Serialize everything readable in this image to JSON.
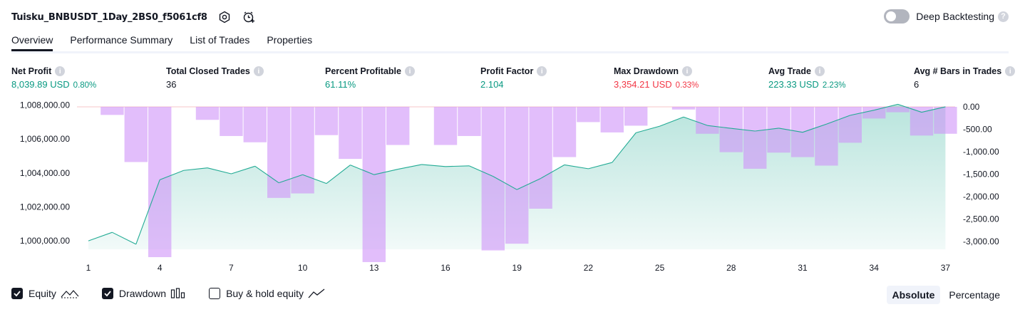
{
  "header": {
    "title": "Tuisku_BNBUSDT_1Day_2BS0_f5061cf8",
    "deep_backtesting_label": "Deep Backtesting",
    "deep_backtesting_on": false
  },
  "tabs": [
    {
      "label": "Overview",
      "active": true
    },
    {
      "label": "Performance Summary",
      "active": false
    },
    {
      "label": "List of Trades",
      "active": false
    },
    {
      "label": "Properties",
      "active": false
    }
  ],
  "metrics": [
    {
      "label": "Net Profit",
      "value": "8,039.89 USD",
      "percent": "0.80%",
      "tone": "pos"
    },
    {
      "label": "Total Closed Trades",
      "value": "36",
      "percent": "",
      "tone": "neu"
    },
    {
      "label": "Percent Profitable",
      "value": "61.11%",
      "percent": "",
      "tone": "pos"
    },
    {
      "label": "Profit Factor",
      "value": "2.104",
      "percent": "",
      "tone": "pos"
    },
    {
      "label": "Max Drawdown",
      "value": "3,354.21 USD",
      "percent": "0.33%",
      "tone": "neg"
    },
    {
      "label": "Avg Trade",
      "value": "223.33 USD",
      "percent": "2.23%",
      "tone": "pos"
    },
    {
      "label": "Avg # Bars in Trades",
      "value": "6",
      "percent": "",
      "tone": "neu"
    }
  ],
  "legend": {
    "equity": "Equity",
    "equity_on": true,
    "drawdown": "Drawdown",
    "drawdown_on": true,
    "buyhold": "Buy & hold equity",
    "buyhold_on": false
  },
  "modes": {
    "absolute": "Absolute",
    "percentage": "Percentage",
    "active": "absolute"
  },
  "chart_data": {
    "type": "line",
    "x": [
      1,
      2,
      3,
      4,
      5,
      6,
      7,
      8,
      9,
      10,
      11,
      12,
      13,
      14,
      15,
      16,
      17,
      18,
      19,
      20,
      21,
      22,
      23,
      24,
      25,
      26,
      27,
      28,
      29,
      30,
      31,
      32,
      33,
      34,
      35,
      36,
      37
    ],
    "x_ticks": [
      "1",
      "4",
      "7",
      "10",
      "13",
      "16",
      "19",
      "22",
      "25",
      "28",
      "31",
      "34",
      "37"
    ],
    "y_left_ticks": [
      "1,008,000.00",
      "1,006,000.00",
      "1,004,000.00",
      "1,002,000.00",
      "1,000,000.00"
    ],
    "y_right_ticks": [
      "0.00",
      "-500.00",
      "-1,000.00",
      "-1,500.00",
      "-2,000.00",
      "-2,500.00",
      "-3,000.00"
    ],
    "ylim_left": [
      999500,
      1008150
    ],
    "ylim_right": [
      -3350,
      0
    ],
    "equity_color": "#22ab94",
    "drawdown_color": "#ce93f8",
    "series": [
      {
        "name": "Equity",
        "values": [
          1000000,
          1000500,
          999800,
          1003600,
          1004150,
          1004300,
          1003950,
          1004400,
          1003420,
          1003900,
          1003380,
          1004470,
          1003900,
          1004220,
          1004500,
          1004380,
          1004420,
          1003800,
          1003020,
          1003680,
          1004480,
          1004250,
          1004620,
          1006370,
          1006760,
          1007300,
          1006800,
          1006630,
          1006470,
          1006640,
          1006400,
          1006880,
          1007400,
          1007700,
          1008050,
          1007580,
          1007900
        ]
      },
      {
        "name": "Drawdown",
        "values": [
          0,
          -180,
          -1230,
          -3350,
          0,
          -290,
          -650,
          -790,
          -2030,
          -1930,
          -630,
          -1160,
          -3460,
          -850,
          0,
          -850,
          -650,
          -3200,
          -3050,
          -2270,
          -1120,
          -340,
          -570,
          -420,
          0,
          -60,
          -600,
          -1010,
          -1380,
          -1020,
          -1120,
          -1310,
          -800,
          -260,
          -120,
          -640,
          -600
        ]
      }
    ]
  }
}
